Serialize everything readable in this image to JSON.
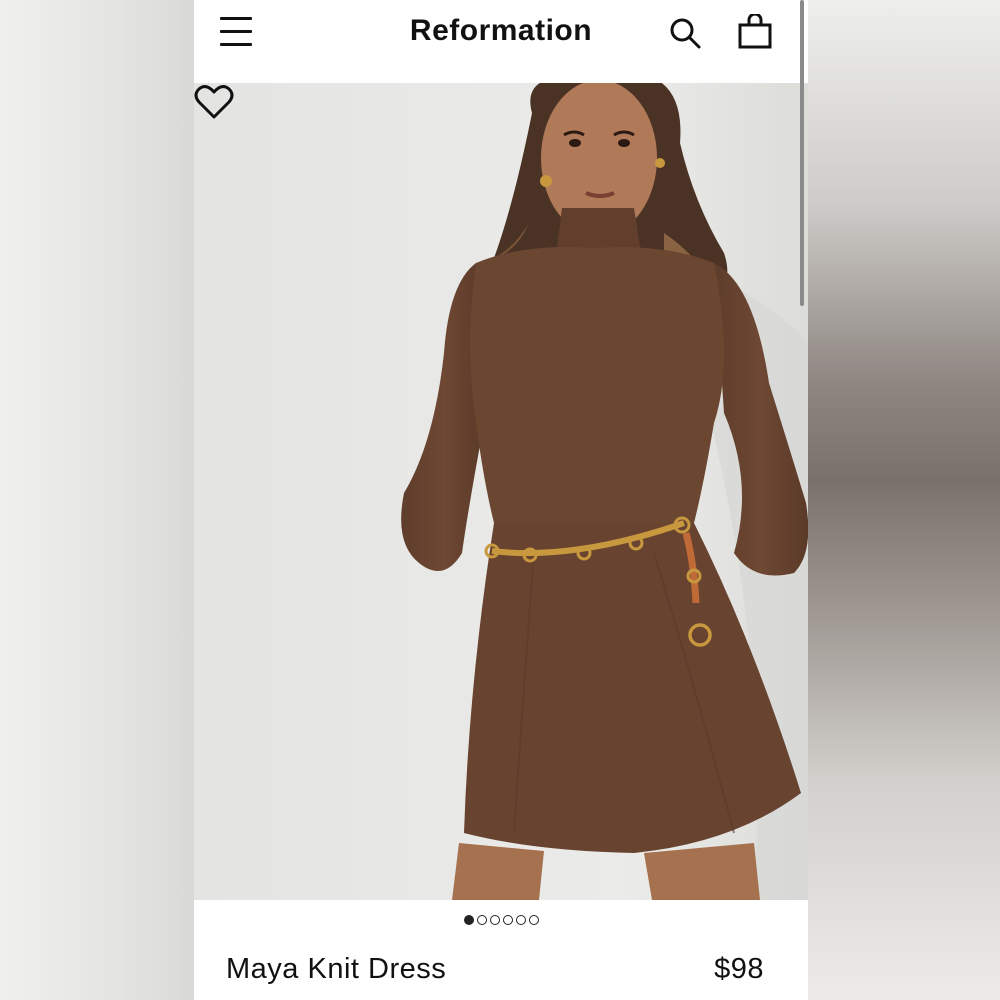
{
  "header": {
    "brand": "Reformation",
    "icons": {
      "menu": "hamburger-menu-icon",
      "search": "search-icon",
      "bag": "shopping-bag-icon"
    }
  },
  "gallery": {
    "favorite_icon": "heart-icon",
    "image_count": 6,
    "active_index": 0
  },
  "product": {
    "name": "Maya Knit Dress",
    "price": "$98"
  },
  "colors": {
    "dress": "#6b4631",
    "background": "#e6e6e4",
    "text": "#111111"
  }
}
